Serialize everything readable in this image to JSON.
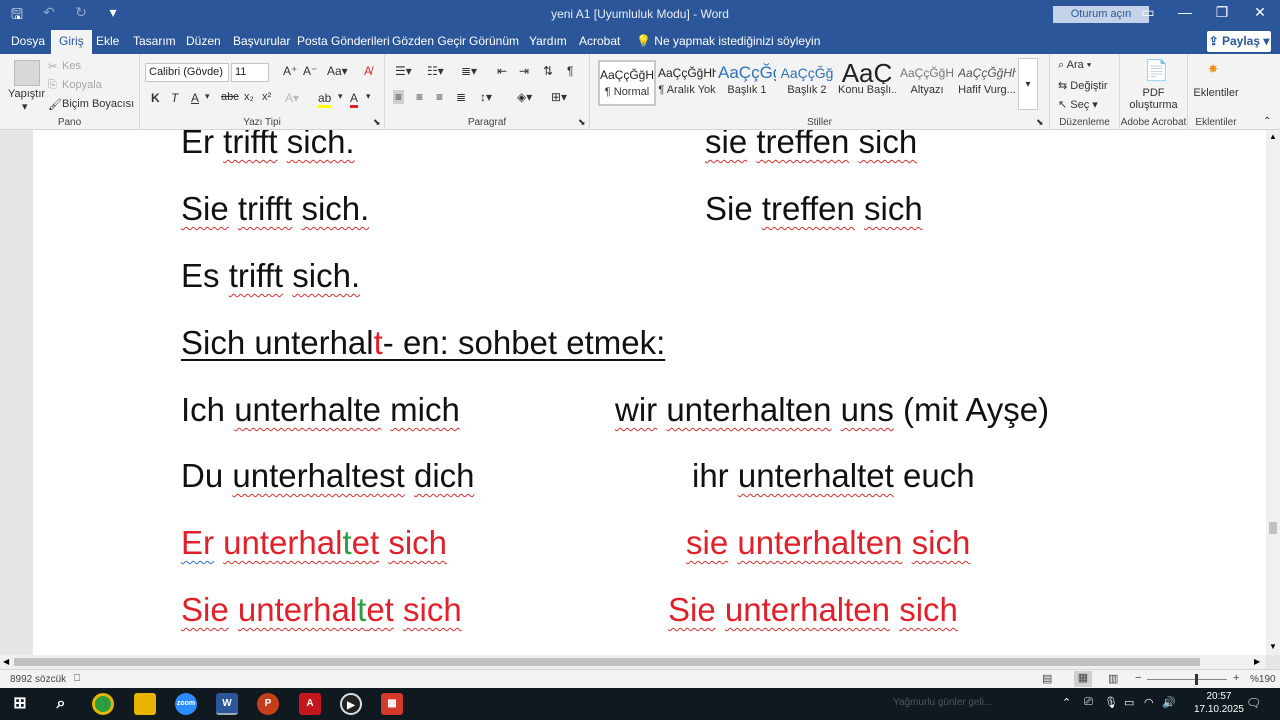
{
  "titlebar": {
    "title": "yeni A1 [Uyumluluk Modu]  -  Word",
    "signin_label": "Oturum açın",
    "qat_save_icon": "save-icon",
    "qat_undo_icon": "undo-icon",
    "qat_redo_icon": "redo-icon"
  },
  "tabs": [
    "Dosya",
    "Giriş",
    "Ekle",
    "Tasarım",
    "Düzen",
    "Başvurular",
    "Posta Gönderileri",
    "Gözden Geçir",
    "Görünüm",
    "Yardım",
    "Acrobat"
  ],
  "active_tab": "Giriş",
  "tellme": "Ne yapmak istediğinizi söyleyin",
  "share_label": "Paylaş",
  "ribbon": {
    "pano": {
      "label": "Pano",
      "paste": "Yapıştır",
      "cut": "Kes",
      "copy": "Kopyala",
      "format_painter": "Biçim Boyacısı"
    },
    "font": {
      "label": "Yazı Tipi",
      "font_name": "Calibri (Gövde)",
      "font_size": "11",
      "bold": "K",
      "italic": "T",
      "underline": "A"
    },
    "paragraph": {
      "label": "Paragraf"
    },
    "styles": {
      "label": "Stiller",
      "items": [
        {
          "sample": "AaÇçĞğHh",
          "name": "¶ Normal"
        },
        {
          "sample": "AaÇçĞğHh",
          "name": "¶ Aralık Yok"
        },
        {
          "sample": "AaÇçĞģ",
          "name": "Başlık 1"
        },
        {
          "sample": "AaÇçĞğ",
          "name": "Başlık 2"
        },
        {
          "sample": "AaÇ",
          "name": "Konu Başlı..."
        },
        {
          "sample": "AaÇçĞğH",
          "name": "Altyazı"
        },
        {
          "sample": "AaÇçĞğHh",
          "name": "Hafif Vurg..."
        }
      ]
    },
    "editing": {
      "label": "Düzenleme",
      "find": "Ara",
      "replace": "Değiştir",
      "select": "Seç"
    },
    "acrobat": {
      "label": "Adobe Acrobat",
      "pdf_line1": "PDF",
      "pdf_line2": "oluşturma"
    },
    "addins": {
      "label": "Eklentiler",
      "button": "Eklentiler"
    }
  },
  "document": {
    "row1_left": [
      "Er",
      "trifft",
      "sich."
    ],
    "row1_right": [
      "sie",
      "treffen",
      "sich"
    ],
    "row2_left": [
      "Sie",
      "trifft",
      "sich."
    ],
    "row2_right": [
      "Sie",
      "treffen",
      "sich"
    ],
    "row3_left": [
      "Es",
      "trifft",
      "sich."
    ],
    "heading_a": "Sich unterhal",
    "heading_t": "t",
    "heading_b": "- en: sohbet etmek:",
    "row5_left": [
      "Ich",
      "unterhalte",
      "mich"
    ],
    "row5_right_a": [
      "wir",
      "unterhalten",
      "uns"
    ],
    "row5_right_b": "(mit Ayşe)",
    "row6_left": [
      "Du",
      "unterhaltest",
      "dich"
    ],
    "row6_right": [
      "ihr",
      "unterhaltet",
      "euch"
    ],
    "row7_left_a": "Er",
    "row7_left_b": "unterhal",
    "row7_left_t": "t",
    "row7_left_c": "et",
    "row7_left_d": "sich",
    "row7_right": [
      "sie",
      "unterhalten",
      "sich"
    ],
    "row8_left_a": "Sie",
    "row8_left_b": "unterhal",
    "row8_left_t": "t",
    "row8_left_c": "et",
    "row8_left_d": "sich",
    "row8_right": [
      "Sie",
      "unterhalten",
      "sich"
    ]
  },
  "status": {
    "word_count": "8992 sözcük",
    "zoom": "%190"
  },
  "taskbar": {
    "time": "20:57",
    "date": "17.10.2025",
    "notification_text": "Yağmurlu günler geli..."
  },
  "colors": {
    "word_blue": "#2b579a",
    "doc_red": "#e0202a",
    "doc_green": "#2aa040"
  }
}
